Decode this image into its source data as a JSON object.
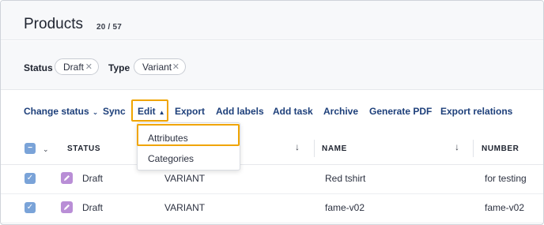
{
  "header": {
    "title": "Products",
    "count": "20 / 57"
  },
  "filters": [
    {
      "label": "Status",
      "value": "Draft"
    },
    {
      "label": "Type",
      "value": "Variant"
    }
  ],
  "toolbar": {
    "change_status": "Change status",
    "sync": "Sync",
    "edit": "Edit",
    "export": "Export",
    "add_labels": "Add labels",
    "add_task": "Add task",
    "archive": "Archive",
    "generate_pdf": "Generate PDF",
    "export_relations": "Export relations"
  },
  "edit_menu": {
    "items": [
      "Attributes",
      "Categories"
    ],
    "highlighted": "Attributes"
  },
  "table": {
    "columns": [
      "STATUS",
      "NAME",
      "NUMBER"
    ],
    "rows": [
      {
        "status": "Draft",
        "type": "VARIANT",
        "name": "Red tshirt",
        "number": "for testing",
        "checked": true
      },
      {
        "status": "Draft",
        "type": "VARIANT",
        "name": "fame-v02",
        "number": "fame-v02",
        "checked": true
      }
    ]
  },
  "colors": {
    "accent": "#f0a500",
    "link": "#1d3f7a",
    "checkbox": "#7aa3d8",
    "draft_icon": "#b98ed6"
  }
}
